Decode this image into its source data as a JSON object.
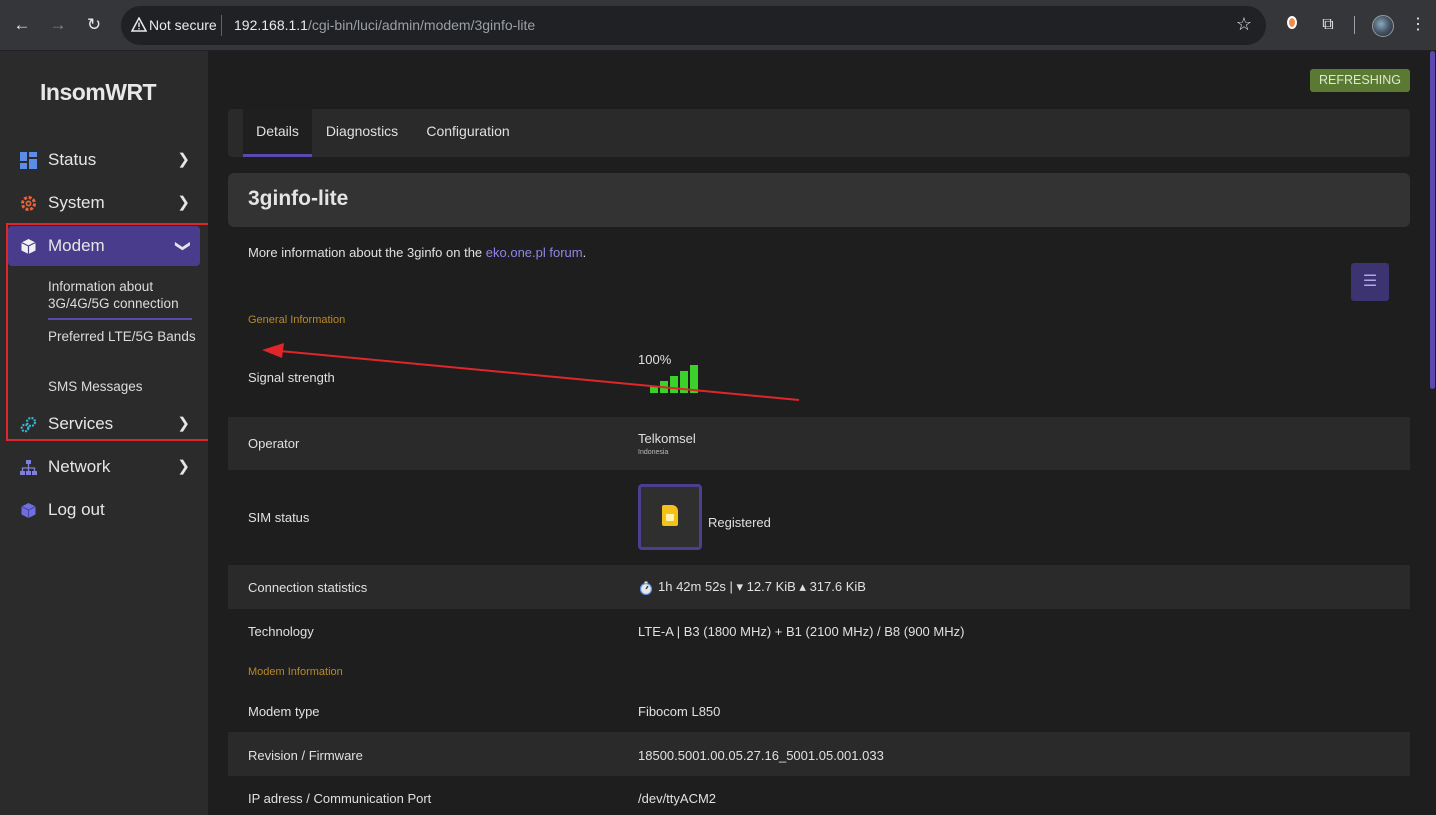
{
  "browser": {
    "security_label": "Not secure",
    "url_host": "192.168.1.1",
    "url_path": "/cgi-bin/luci/admin/modem/3ginfo-lite"
  },
  "sidebar": {
    "brand": "InsomWRT",
    "items": [
      {
        "label": "Status",
        "icon": "grid-icon"
      },
      {
        "label": "System",
        "icon": "gear-icon"
      },
      {
        "label": "Modem",
        "icon": "cube-icon"
      },
      {
        "label": "Services",
        "icon": "cogs-icon"
      },
      {
        "label": "Network",
        "icon": "network-icon"
      },
      {
        "label": "Log out",
        "icon": "logout-icon"
      }
    ],
    "modem_submenu": [
      "Information about 3G/4G/5G connection",
      "Preferred LTE/5G Bands",
      "SMS Messages"
    ]
  },
  "badge": "REFRESHING",
  "tabs": [
    "Details",
    "Diagnostics",
    "Configuration"
  ],
  "page_title": "3ginfo-lite",
  "description": {
    "prefix": "More information about the 3ginfo on the ",
    "link": "eko.one.pl forum",
    "suffix": "."
  },
  "sections": {
    "general": "General Information",
    "modem": "Modem Information"
  },
  "rows": {
    "signal": {
      "label": "Signal strength",
      "value": "100%",
      "bars_fraction": 1.0
    },
    "operator": {
      "label": "Operator",
      "value": "Telkomsel",
      "sub": "Indonesia"
    },
    "sim": {
      "label": "SIM status",
      "value": "Registered"
    },
    "conn": {
      "label": "Connection statistics",
      "value": "1h 42m 52s | ▾ 12.7 KiB ▴ 317.6 KiB"
    },
    "tech": {
      "label": "Technology",
      "value": "LTE-A | B3 (1800 MHz) + B1 (2100 MHz) / B8 (900 MHz)"
    },
    "modem_type": {
      "label": "Modem type",
      "value": "Fibocom L850"
    },
    "firmware": {
      "label": "Revision / Firmware",
      "value": "18500.5001.00.05.27.16_5001.05.001.033"
    },
    "port": {
      "label": "IP adress / Communication Port",
      "value": "/dev/ttyACM2"
    }
  },
  "colors": {
    "accent": "#4a3c8c",
    "badge": "#5a7a33",
    "section": "#b8892a",
    "signal": "#39d12a",
    "annotation": "#e0262b"
  }
}
